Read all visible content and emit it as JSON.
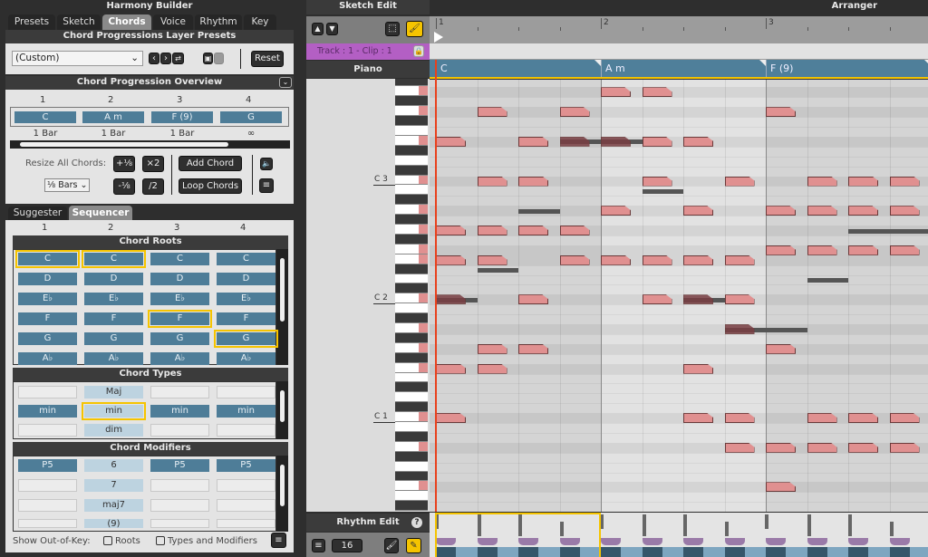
{
  "left": {
    "title": "Harmony Builder",
    "tabs": [
      "Presets",
      "Sketch",
      "Chords",
      "Voice",
      "Rhythm",
      "Key"
    ],
    "active_tab": "Chords",
    "presets_header": "Chord Progressions Layer Presets",
    "preset_value": "(Custom)",
    "reset_label": "Reset",
    "overview_header": "Chord Progression Overview",
    "overview": {
      "numbers": [
        "1",
        "2",
        "3",
        "4"
      ],
      "chords": [
        "C",
        "A m",
        "F (9)",
        "G"
      ],
      "lengths": [
        "1 Bar",
        "1 Bar",
        "1 Bar",
        "∞"
      ],
      "resize_label": "Resize All Chords:",
      "plus": "+⅛",
      "times2": "×2",
      "minus": "-⅛",
      "div2": "/2",
      "add_chord": "Add Chord",
      "loop_chords": "Loop Chords",
      "bars_select": "⅛ Bars"
    },
    "subtabs": [
      "Suggester",
      "Sequencer"
    ],
    "active_subtab": "Sequencer",
    "sequencer": {
      "columns": [
        "1",
        "2",
        "3",
        "4"
      ],
      "roots_header": "Chord Roots",
      "roots": [
        "C",
        "D",
        "E♭",
        "F",
        "G",
        "A♭"
      ],
      "roots_selected": [
        "C",
        "C",
        "F",
        "G"
      ],
      "types_header": "Chord Types",
      "types": [
        [
          "",
          "Maj",
          "",
          ""
        ],
        [
          "min",
          "min",
          "min",
          "min"
        ],
        [
          "",
          "dim",
          "",
          ""
        ]
      ],
      "types_selected_row": 1,
      "modifiers_header": "Chord Modifiers",
      "modifiers": [
        [
          "P5",
          "6",
          "P5",
          "P5"
        ],
        [
          "",
          "7",
          "",
          ""
        ],
        [
          "",
          "maj7",
          "",
          ""
        ],
        [
          "",
          "(9)",
          "",
          ""
        ]
      ],
      "show_label": "Show Out-of-Key:",
      "roots_check": "Roots",
      "types_check": "Types and Modifiers"
    }
  },
  "right": {
    "sketch_edit": "Sketch Edit",
    "arranger": "Arranger",
    "track_label": "Track : 1 - Clip : 1",
    "piano": "Piano",
    "ruler": [
      "1",
      "2",
      "3"
    ],
    "chord_lane": [
      "C",
      "A m",
      "F (9)"
    ],
    "octave_labels": [
      "C 3",
      "C 2",
      "C 1"
    ],
    "rhythm_edit": "Rhythm Edit",
    "grid_value": "16",
    "colors": {
      "chord": "#4f7f9a",
      "note": "#e09090",
      "accent": "#f5c400",
      "track": "#b35fc4",
      "playhead": "#e8401c"
    }
  },
  "notes_legend": "pitch in semitones relative to C3, start in quarter beats from bar 1",
  "notes": [
    [
      9,
      4
    ],
    [
      9,
      5
    ],
    [
      7,
      1
    ],
    [
      7,
      3
    ],
    [
      7,
      8
    ],
    [
      4,
      0
    ],
    [
      4,
      2
    ],
    [
      4,
      3,
      1
    ],
    [
      4,
      4,
      1
    ],
    [
      4,
      5
    ],
    [
      4,
      6
    ],
    [
      0,
      1
    ],
    [
      0,
      2
    ],
    [
      0,
      5
    ],
    [
      0,
      7
    ],
    [
      0,
      9
    ],
    [
      0,
      10
    ],
    [
      0,
      11
    ],
    [
      -3,
      4
    ],
    [
      -3,
      6
    ],
    [
      -3,
      8
    ],
    [
      -3,
      9
    ],
    [
      -3,
      10
    ],
    [
      -3,
      11
    ],
    [
      -5,
      0
    ],
    [
      -5,
      1
    ],
    [
      -5,
      2
    ],
    [
      -5,
      3
    ],
    [
      -7,
      8
    ],
    [
      -7,
      9
    ],
    [
      -7,
      10
    ],
    [
      -7,
      11
    ],
    [
      -8,
      0
    ],
    [
      -8,
      1
    ],
    [
      -8,
      3
    ],
    [
      -8,
      4
    ],
    [
      -8,
      5
    ],
    [
      -8,
      6
    ],
    [
      -8,
      7
    ],
    [
      -12,
      0,
      1
    ],
    [
      -12,
      2
    ],
    [
      -12,
      5
    ],
    [
      -12,
      6,
      1
    ],
    [
      -12,
      7
    ],
    [
      -15,
      7,
      1
    ],
    [
      -17,
      1
    ],
    [
      -17,
      2
    ],
    [
      -17,
      8
    ],
    [
      -19,
      0
    ],
    [
      -19,
      1
    ],
    [
      -19,
      6
    ],
    [
      -24,
      0
    ],
    [
      -24,
      6
    ],
    [
      -24,
      7
    ],
    [
      -24,
      9
    ],
    [
      -24,
      10
    ],
    [
      -24,
      11
    ],
    [
      -27,
      7
    ],
    [
      -27,
      8
    ],
    [
      -27,
      9
    ],
    [
      -27,
      10
    ],
    [
      -27,
      11
    ],
    [
      -31,
      8
    ]
  ],
  "ghosts": [
    [
      4,
      3,
      2
    ],
    [
      -1,
      5,
      1
    ],
    [
      -3,
      2,
      1
    ],
    [
      -9,
      1,
      1
    ],
    [
      -10,
      9,
      1
    ],
    [
      -5,
      10,
      2
    ],
    [
      -12,
      0,
      1
    ],
    [
      -12,
      6,
      1
    ],
    [
      -15,
      7,
      2
    ]
  ]
}
